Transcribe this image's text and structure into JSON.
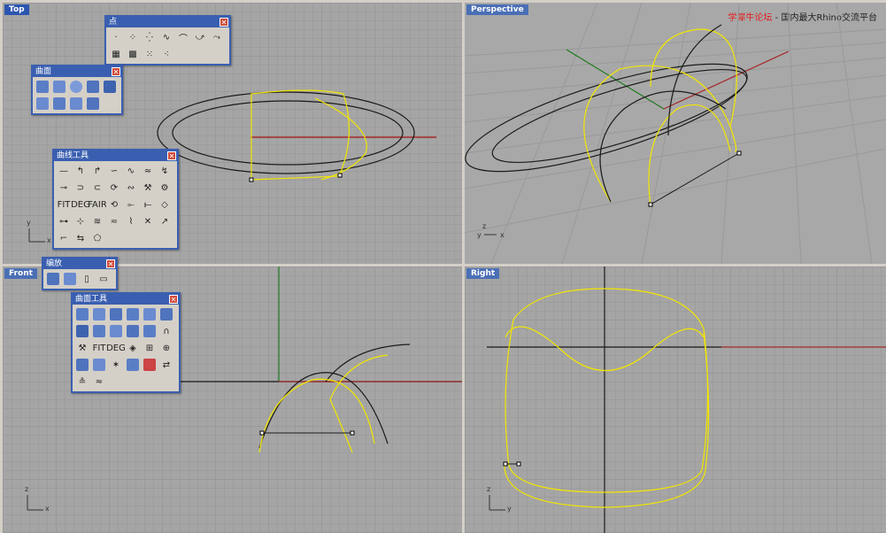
{
  "viewports": {
    "top": {
      "label": "Top"
    },
    "perspective": {
      "label": "Perspective"
    },
    "front": {
      "label": "Front"
    },
    "right": {
      "label": "Right"
    }
  },
  "watermark": {
    "site": "学犀牛论坛",
    "sep": " - ",
    "tagline": "国内最大Rhino交流平台"
  },
  "toolbars": {
    "points": {
      "title": "点",
      "rows": 2,
      "cols": 7,
      "count": 11
    },
    "surface": {
      "title": "曲面",
      "rows": 2,
      "cols": 5,
      "count": 9
    },
    "curve_tools": {
      "title": "曲线工具",
      "rows": 5,
      "cols": 7,
      "count": 33,
      "labels": [
        "FIT",
        "DEG",
        "FAIR"
      ]
    },
    "zoom": {
      "title": "编放",
      "rows": 1,
      "cols": 4,
      "count": 4
    },
    "surface_tools": {
      "title": "曲面工具",
      "rows": 5,
      "cols": 6,
      "count": 26,
      "labels": [
        "FIT",
        "DEG"
      ]
    }
  },
  "axes": {
    "top": {
      "a": "y",
      "b": "x"
    },
    "perspective": {
      "a": "z",
      "b": "y",
      "c": "x"
    },
    "front": {
      "a": "z",
      "b": "x"
    },
    "right": {
      "a": "z",
      "b": "y"
    }
  },
  "colors": {
    "curve_yellow": "#f2e600",
    "curve_black": "#1a1a1a",
    "x_axis": "#a52a2a",
    "y_axis": "#1f7a1f",
    "title_blue": "#3a5fb0"
  }
}
